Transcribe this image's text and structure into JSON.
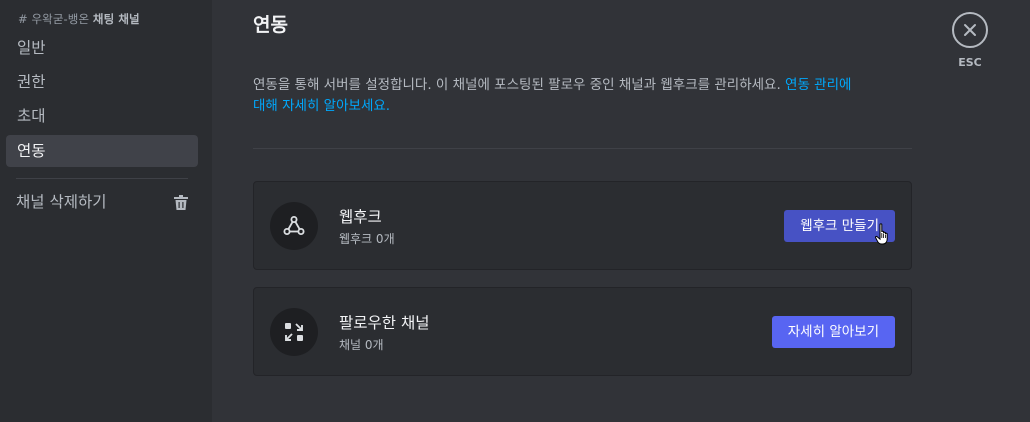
{
  "sidebar": {
    "header_prefix": "# 우왁굳-뱅온 ",
    "header_channel": "채팅 채널",
    "items": [
      {
        "label": "일반"
      },
      {
        "label": "권한"
      },
      {
        "label": "초대"
      },
      {
        "label": "연동",
        "active": true
      }
    ],
    "delete_label": "채널 삭제하기"
  },
  "main": {
    "title": "연동",
    "description": "연동을 통해 서버를 설정합니다. 이 채널에 포스팅된 팔로우 중인 채널과 웹후크를 관리하세요.",
    "description_link_line1": "연동 관리에",
    "description_link_line2": "대해 자세히 알아보세요.",
    "cards": [
      {
        "title": "웹후크",
        "subtitle": "웹후크 0개",
        "icon": "webhook-icon",
        "button_label": "웹후크 만들기"
      },
      {
        "title": "팔로우한 채널",
        "subtitle": "채널 0개",
        "icon": "channel-follow-icon",
        "button_label": "자세히 알아보기"
      }
    ]
  },
  "close": {
    "label": "ESC"
  },
  "colors": {
    "accent": "#5865f2",
    "link": "#00a8fc",
    "background": "#313338",
    "sidebar": "#2b2d31"
  }
}
